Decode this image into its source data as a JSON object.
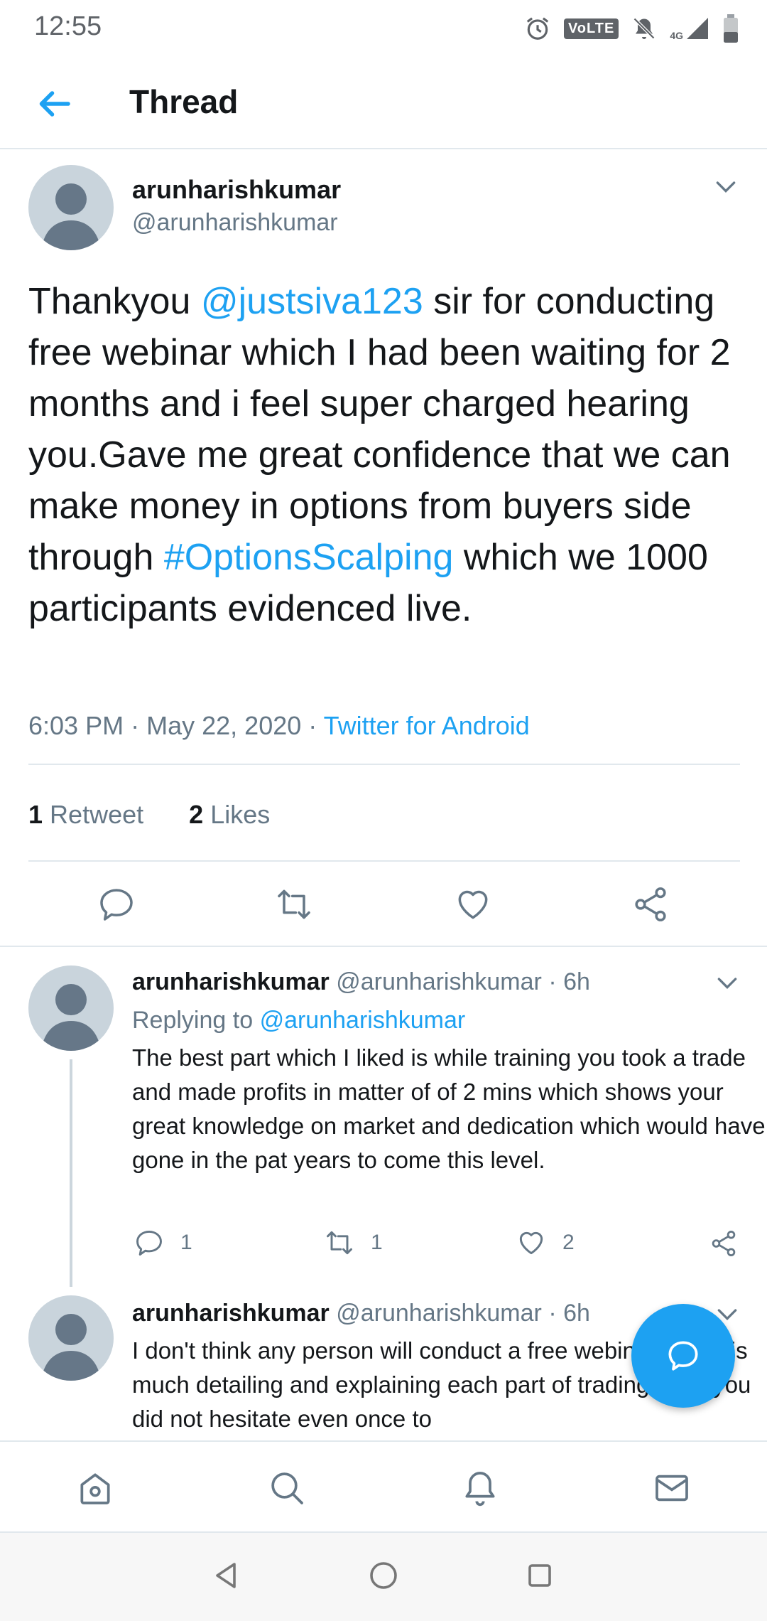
{
  "status_bar": {
    "time": "12:55",
    "volte": "VoLTE",
    "network": "4G"
  },
  "header": {
    "title": "Thread"
  },
  "tweet": {
    "author_name": "arunharishkumar",
    "author_handle": "@arunharishkumar",
    "text_part1": "Thankyou ",
    "mention": "@justsiva123",
    "text_part2": " sir for conducting free webinar which I had been waiting for 2 months and i feel super charged hearing you.Gave me great confidence that we can make money in options from buyers side through ",
    "hashtag": "#OptionsScalping",
    "text_part3": " which we 1000 participants evidenced live.",
    "time": "6:03 PM",
    "date": "May 22, 2020",
    "separator": "·",
    "source": "Twitter for Android",
    "retweet_count": "1",
    "retweet_label": "Retweet",
    "like_count": "2",
    "like_label": "Likes"
  },
  "replies": [
    {
      "name": "arunharishkumar",
      "handle": "@arunharishkumar",
      "dot": "·",
      "age": "6h",
      "replying_label": "Replying to",
      "replying_to": "@arunharishkumar",
      "text": "The best part which I liked is while training you took a trade and made profits in matter of of 2 mins which shows your great knowledge on market and dedication which would have gone in the pat years to come this level.",
      "reply_count": "1",
      "retweet_count": "1",
      "like_count": "2"
    },
    {
      "name": "arunharishkumar",
      "handle": "@arunharishkumar",
      "dot": "·",
      "age": "6h",
      "text": "I don't think any person will conduct a free webinar with this much detailing and explaining each part of trading. Also you did not hesitate even once to"
    }
  ],
  "icons": {
    "accent": "#1da1f2",
    "muted": "#657786",
    "tabs": [
      "home-icon",
      "search-icon",
      "notifications-icon",
      "messages-icon"
    ],
    "system_nav": [
      "back-icon",
      "home-circle-icon",
      "recents-icon"
    ]
  }
}
